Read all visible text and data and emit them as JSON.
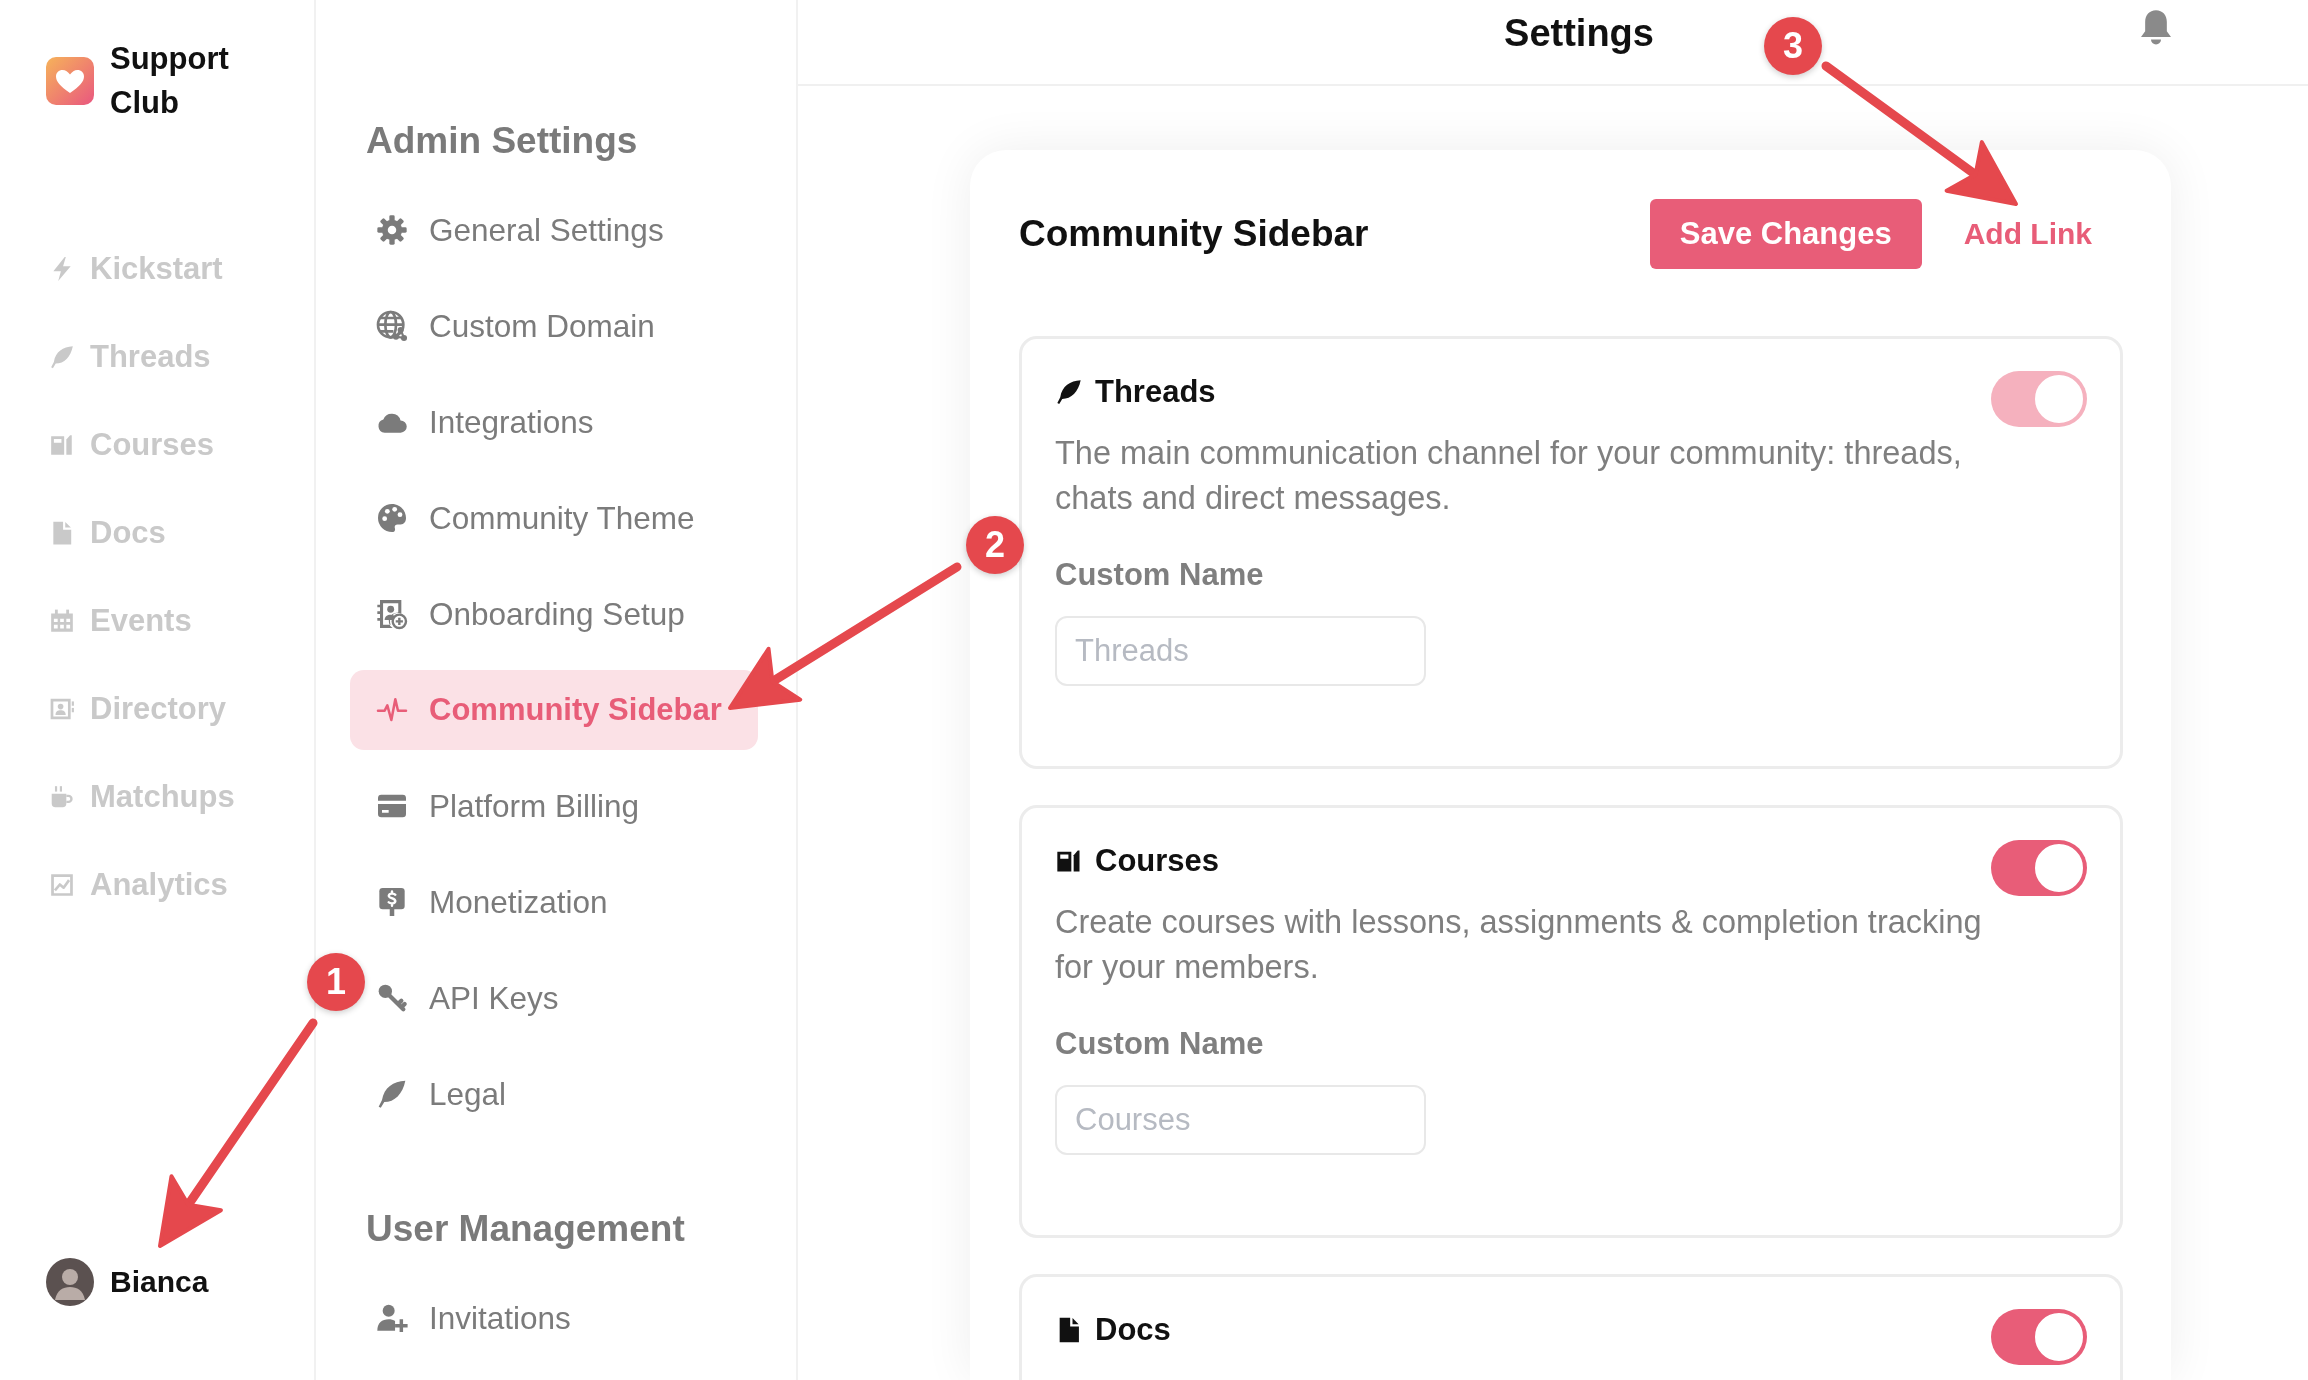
{
  "brand": {
    "name": "Support Club"
  },
  "nav": [
    {
      "label": "Kickstart",
      "selected": false
    },
    {
      "label": "Threads",
      "selected": false
    },
    {
      "label": "Courses",
      "selected": false
    },
    {
      "label": "Docs",
      "selected": false
    },
    {
      "label": "Events",
      "selected": false
    },
    {
      "label": "Directory",
      "selected": false
    },
    {
      "label": "Matchups",
      "selected": false
    },
    {
      "label": "Analytics",
      "selected": false
    }
  ],
  "user": {
    "name": "Bianca"
  },
  "settings_menu": [
    {
      "heading": "Admin Settings",
      "items": [
        {
          "label": "General Settings",
          "selected": false
        },
        {
          "label": "Custom Domain",
          "selected": false
        },
        {
          "label": "Integrations",
          "selected": false
        },
        {
          "label": "Community Theme",
          "selected": false
        },
        {
          "label": "Onboarding Setup",
          "selected": false
        },
        {
          "label": "Community Sidebar",
          "selected": true
        },
        {
          "label": "Platform Billing",
          "selected": false
        },
        {
          "label": "Monetization",
          "selected": false
        },
        {
          "label": "API Keys",
          "selected": false
        },
        {
          "label": "Legal",
          "selected": false
        }
      ]
    },
    {
      "heading": "User Management",
      "items": [
        {
          "label": "Invitations",
          "selected": false
        }
      ]
    }
  ],
  "header": {
    "title": "Settings"
  },
  "panel": {
    "title": "Community Sidebar",
    "actions": [
      {
        "label": "Save Changes",
        "kind": "primary"
      },
      {
        "label": "Add Link",
        "kind": "link"
      }
    ],
    "features": [
      {
        "title": "Threads",
        "description": "The main communication channel for your community: threads, chats and direct messages.",
        "on": true,
        "disabled": true,
        "field_label": "Custom Name",
        "placeholder": "Threads"
      },
      {
        "title": "Courses",
        "description": "Create courses with lessons, assignments & completion tracking for your members.",
        "on": true,
        "disabled": false,
        "field_label": "Custom Name",
        "placeholder": "Courses"
      },
      {
        "title": "Docs",
        "on": true,
        "disabled": false
      }
    ]
  },
  "annotations": [
    {
      "label": "1"
    },
    {
      "label": "2"
    },
    {
      "label": "3"
    }
  ]
}
